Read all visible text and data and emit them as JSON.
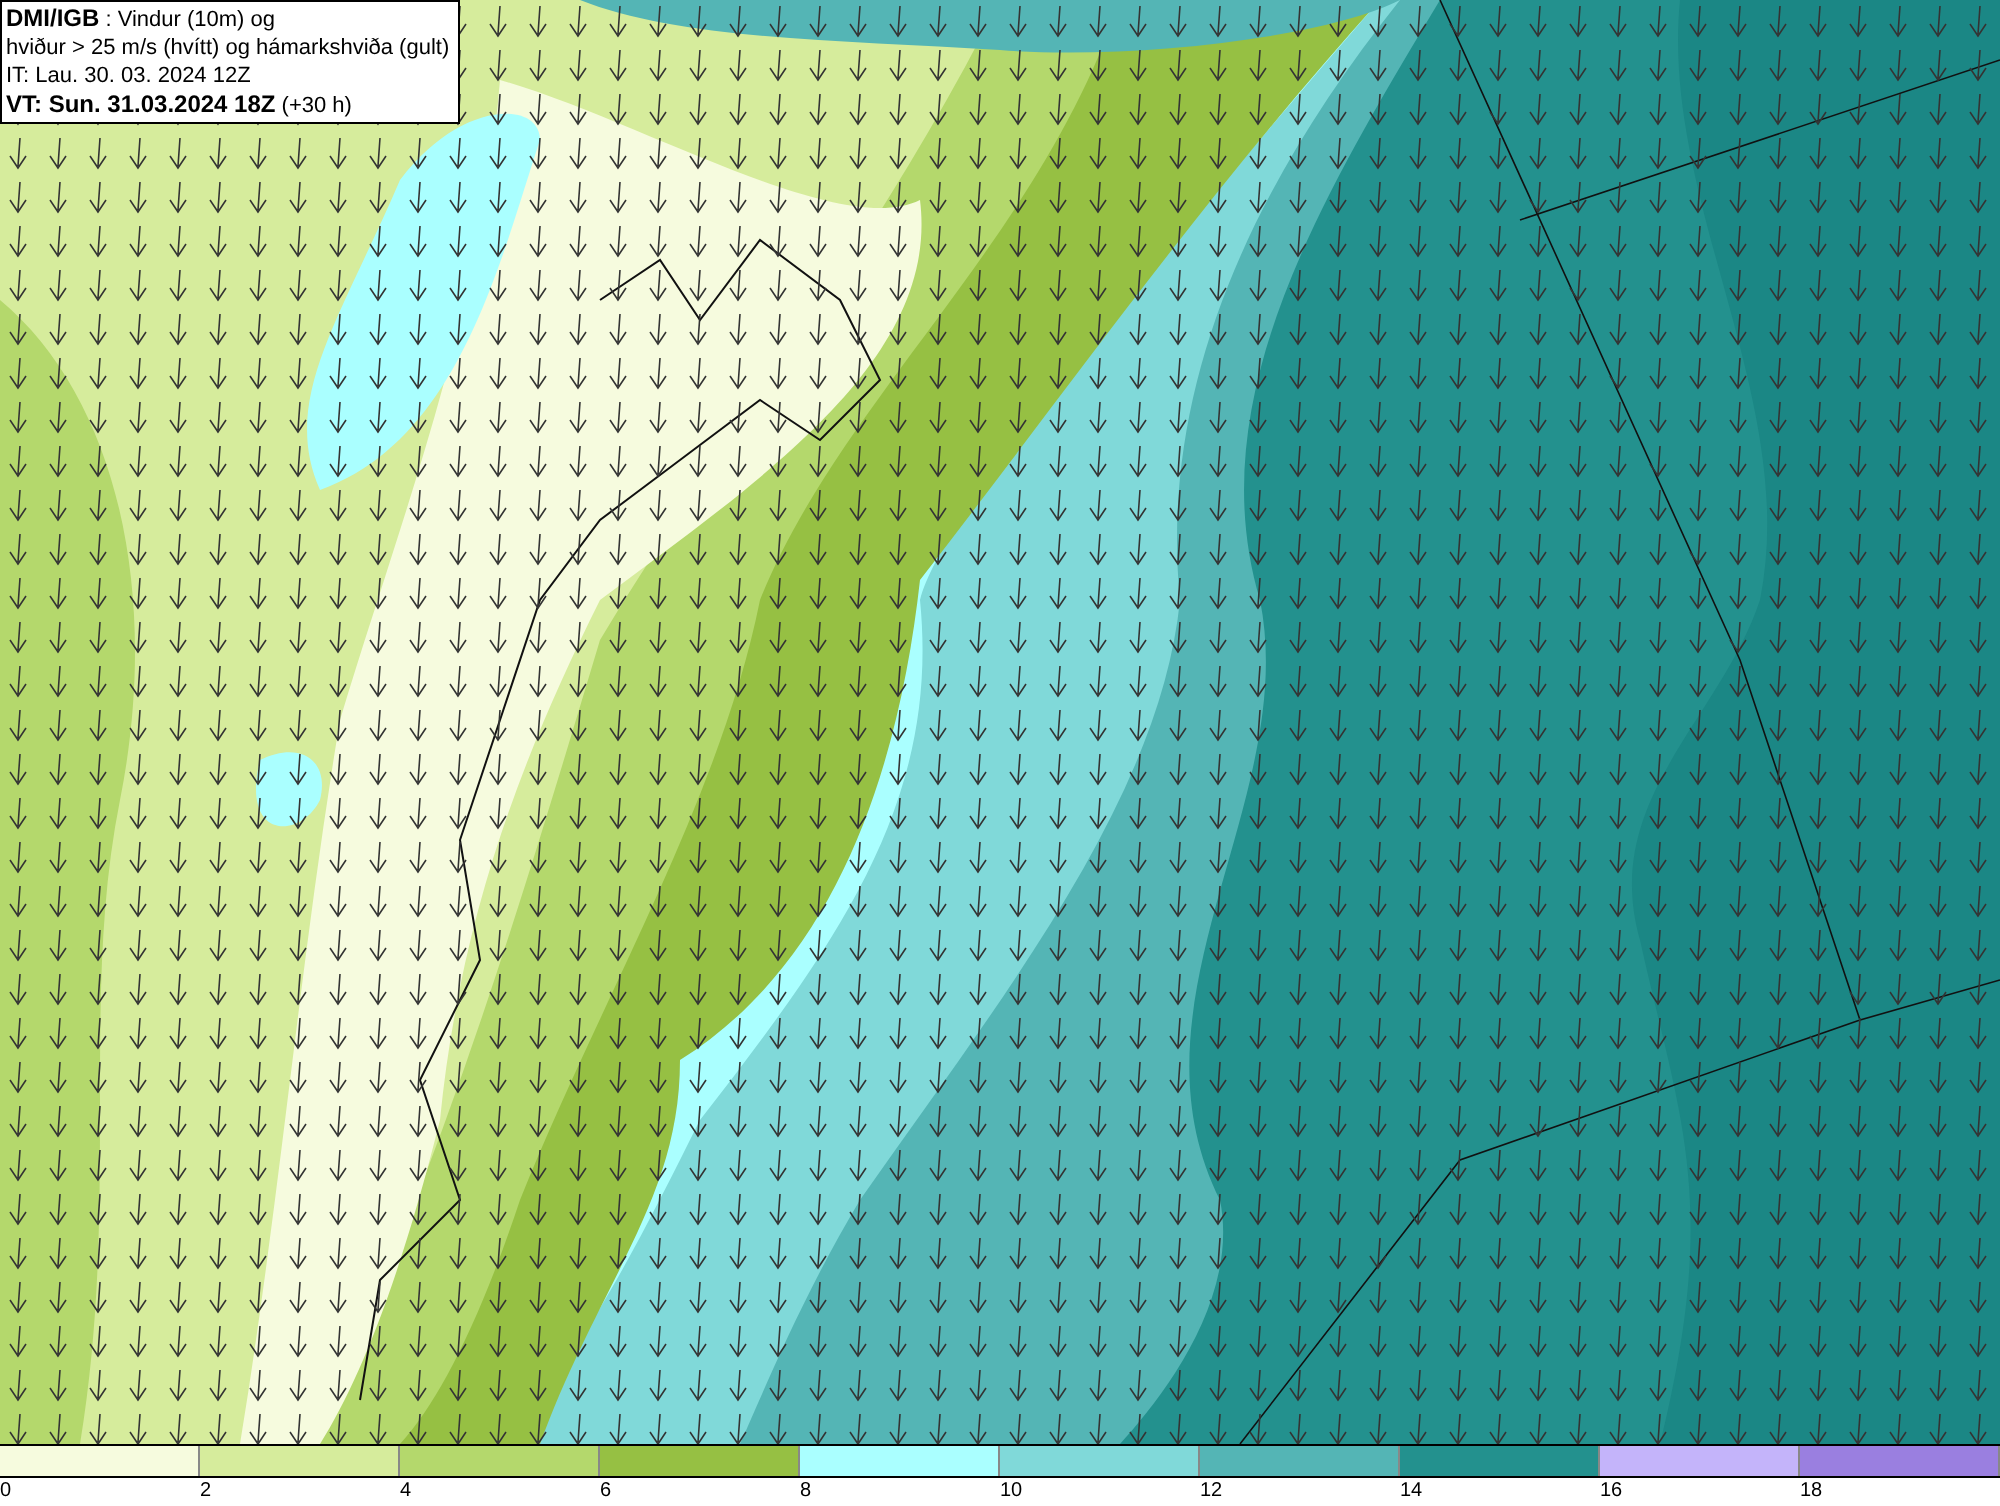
{
  "info_box": {
    "lines": [
      "**DMI/IGB** : Vindur (10m) og",
      "hviður > 25 m/s (hvítt) og hámarkshviða (gult)",
      "IT: Lau. 30. 03. 2024 12Z",
      "**VT: Sun. 31.03.2024 18Z** (+30 h)"
    ]
  },
  "legend": {
    "segments": [
      {
        "color": "#f6fbde"
      },
      {
        "color": "#d6ec9c"
      },
      {
        "color": "#b4d86c"
      },
      {
        "color": "#96c043"
      },
      {
        "color": "#aaffff"
      },
      {
        "color": "#80d9d9"
      },
      {
        "color": "#54b5b5"
      },
      {
        "color": "#23918e"
      },
      {
        "color": "#c4b4fa"
      },
      {
        "color": "#9a7fe0"
      }
    ],
    "ticks": [
      "0",
      "2",
      "4",
      "6",
      "8",
      "10",
      "12",
      "14",
      "16",
      "18"
    ]
  }
}
